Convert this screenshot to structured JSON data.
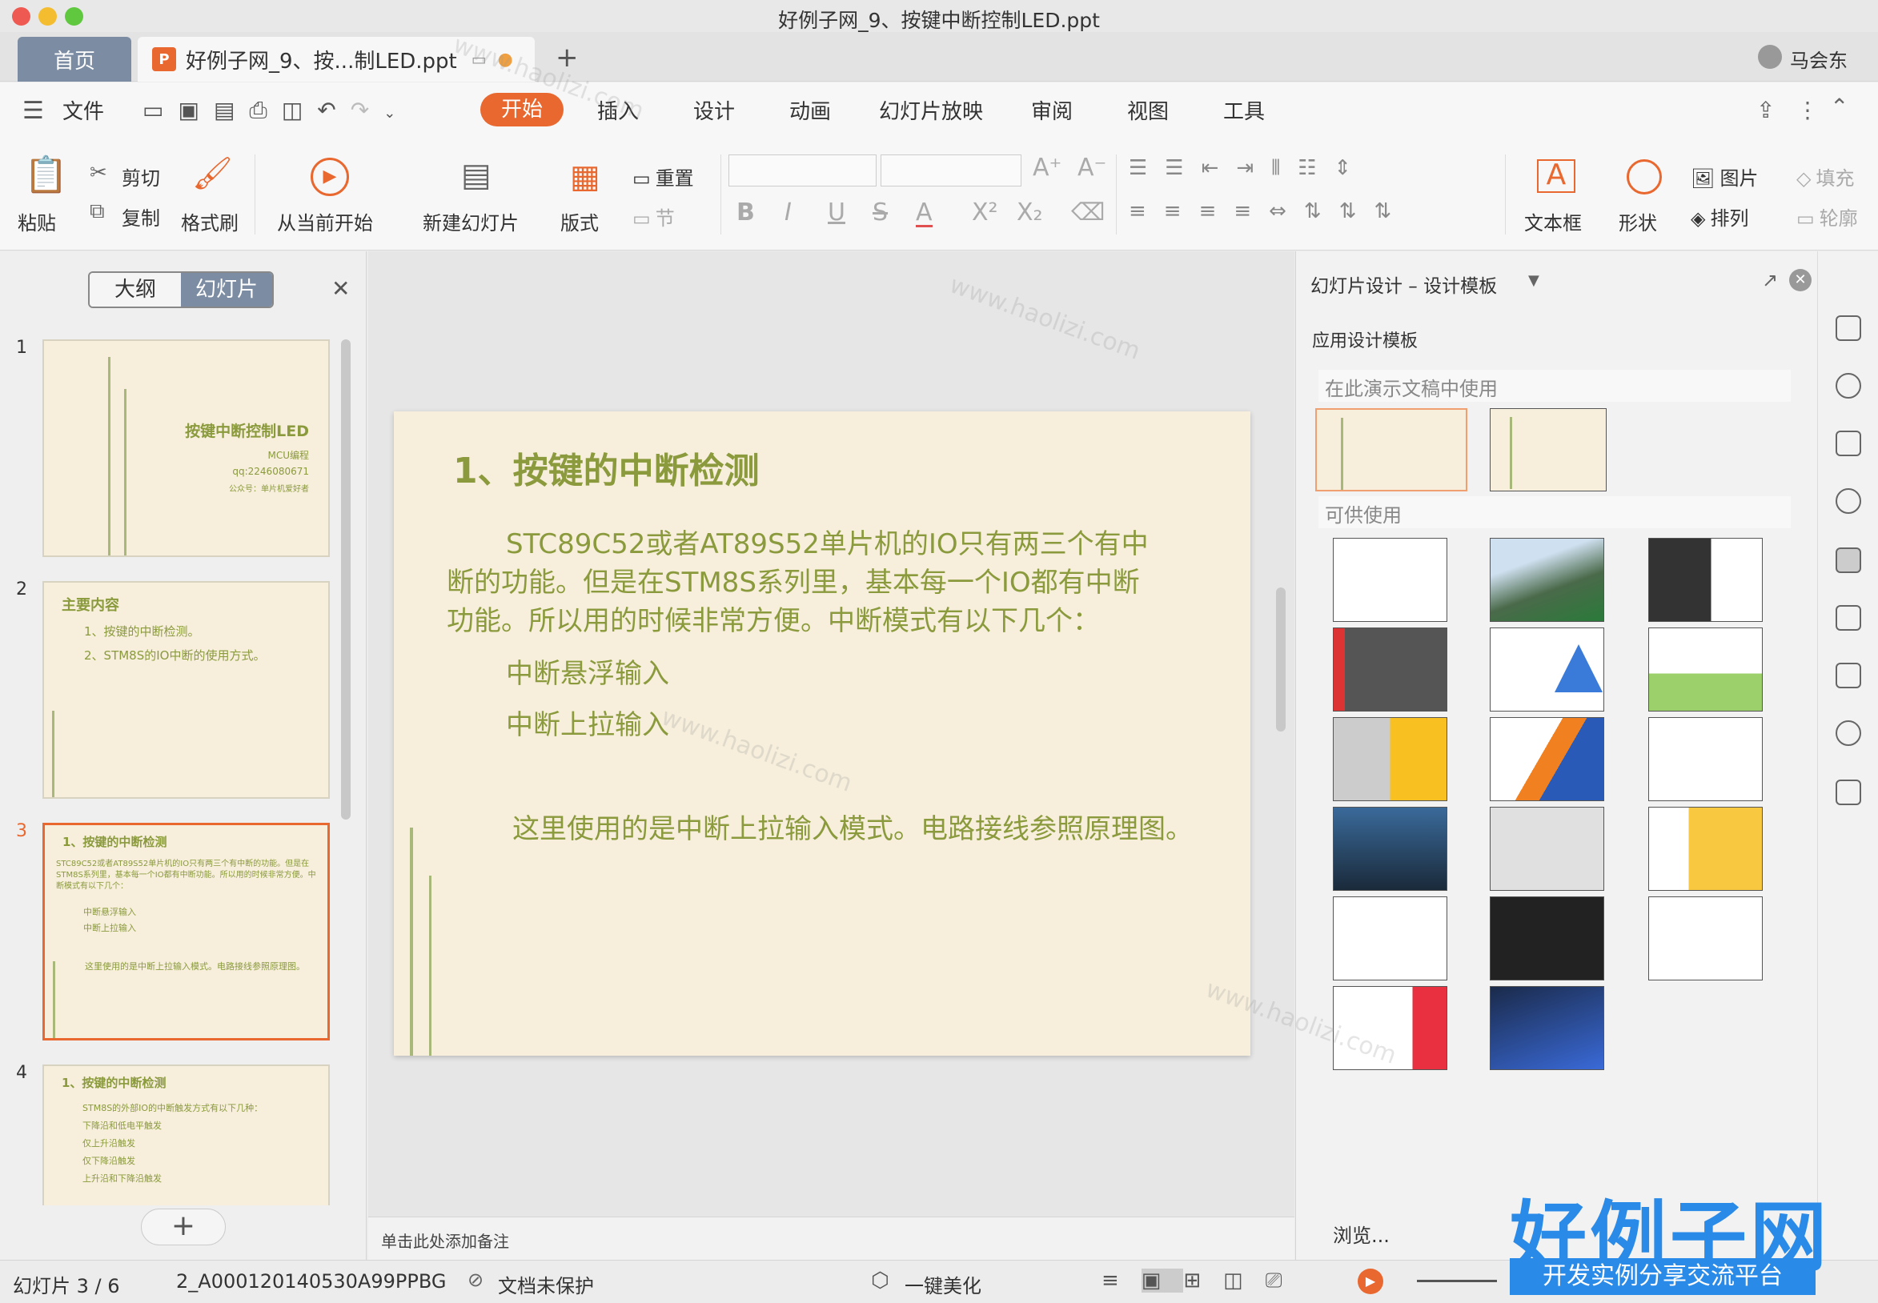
{
  "window": {
    "title": "好例子网_9、按键中断控制LED.ppt"
  },
  "tabs": {
    "home": "首页",
    "doc": "好例子网_9、按...制LED.ppt",
    "user": "马会东"
  },
  "menu": {
    "file": "文件",
    "items": [
      "开始",
      "插入",
      "设计",
      "动画",
      "幻灯片放映",
      "审阅",
      "视图",
      "工具"
    ]
  },
  "ribbon": {
    "paste": "粘贴",
    "cut": "剪切",
    "copy": "复制",
    "format_painter": "格式刷",
    "start_current": "从当前开始",
    "new_slide": "新建幻灯片",
    "layout": "版式",
    "reset": "重置",
    "section": "节",
    "textbox": "文本框",
    "shape": "形状",
    "picture": "图片",
    "arrange": "排列",
    "fill": "填充",
    "outline": "轮廓"
  },
  "left_panel": {
    "tab_outline": "大纲",
    "tab_slides": "幻灯片",
    "slides": [
      {
        "num": "1",
        "title": "按键中断控制LED",
        "lines": [
          "MCU编程",
          "qq:2246080671",
          "公众号：单片机爱好者"
        ]
      },
      {
        "num": "2",
        "title": "主要内容",
        "lines": [
          "1、按键的中断检测。",
          "2、STM8S的IO中断的使用方式。"
        ]
      },
      {
        "num": "3",
        "title": "1、按键的中断检测",
        "lines": [
          "STC89C52或者AT89S52单片机的IO只有两三个有中断的功能。但是在STM8S系列里，基本每一个IO都有中断功能。所以用的时候非常方便。中断模式有以下几个：",
          "中断悬浮输入",
          "中断上拉输入",
          "这里使用的是中断上拉输入模式。电路接线参照原理图。"
        ]
      },
      {
        "num": "4",
        "title": "1、按键的中断检测",
        "lines": [
          "STM8S的外部IO的中断触发方式有以下几种：",
          "下降沿和低电平触发",
          "仅上升沿触发",
          "仅下降沿触发",
          "上升沿和下降沿触发"
        ]
      }
    ],
    "add": "+"
  },
  "slide": {
    "title": "1、按键的中断检测",
    "para": "STC89C52或者AT89S52单片机的IO只有两三个有中断的功能。但是在STM8S系列里，基本每一个IO都有中断功能。所以用的时候非常方便。中断模式有以下几个：",
    "para_line1": "STC89C52或者AT89S52单片机的IO只有两三个有中",
    "para_line2": "断的功能。但是在STM8S系列里，基本每一个IO都有中断",
    "para_line3": "功能。所以用的时候非常方便。中断模式有以下几个：",
    "item1": "中断悬浮输入",
    "item2": "中断上拉输入",
    "note": "这里使用的是中断上拉输入模式。电路接线参照原理图。"
  },
  "notes_placeholder": "单击此处添加备注",
  "right_panel": {
    "title": "幻灯片设计 – 设计模板",
    "apply": "应用设计模板",
    "in_use": "在此演示文稿中使用",
    "available": "可供使用",
    "browse": "浏览..."
  },
  "status": {
    "slide_pos": "幻灯片 3 / 6",
    "template_id": "2_A000120140530A99PPBG",
    "protect": "文档未保护",
    "beautify": "一键美化"
  },
  "watermark": {
    "logo": "好例子网",
    "slogan": "开发实例分享交流平台",
    "text": "www.haolizi.com"
  },
  "colors": {
    "accent": "#e8682f",
    "slide_bg": "#f7efdc",
    "slide_text": "#8a9a3c"
  }
}
